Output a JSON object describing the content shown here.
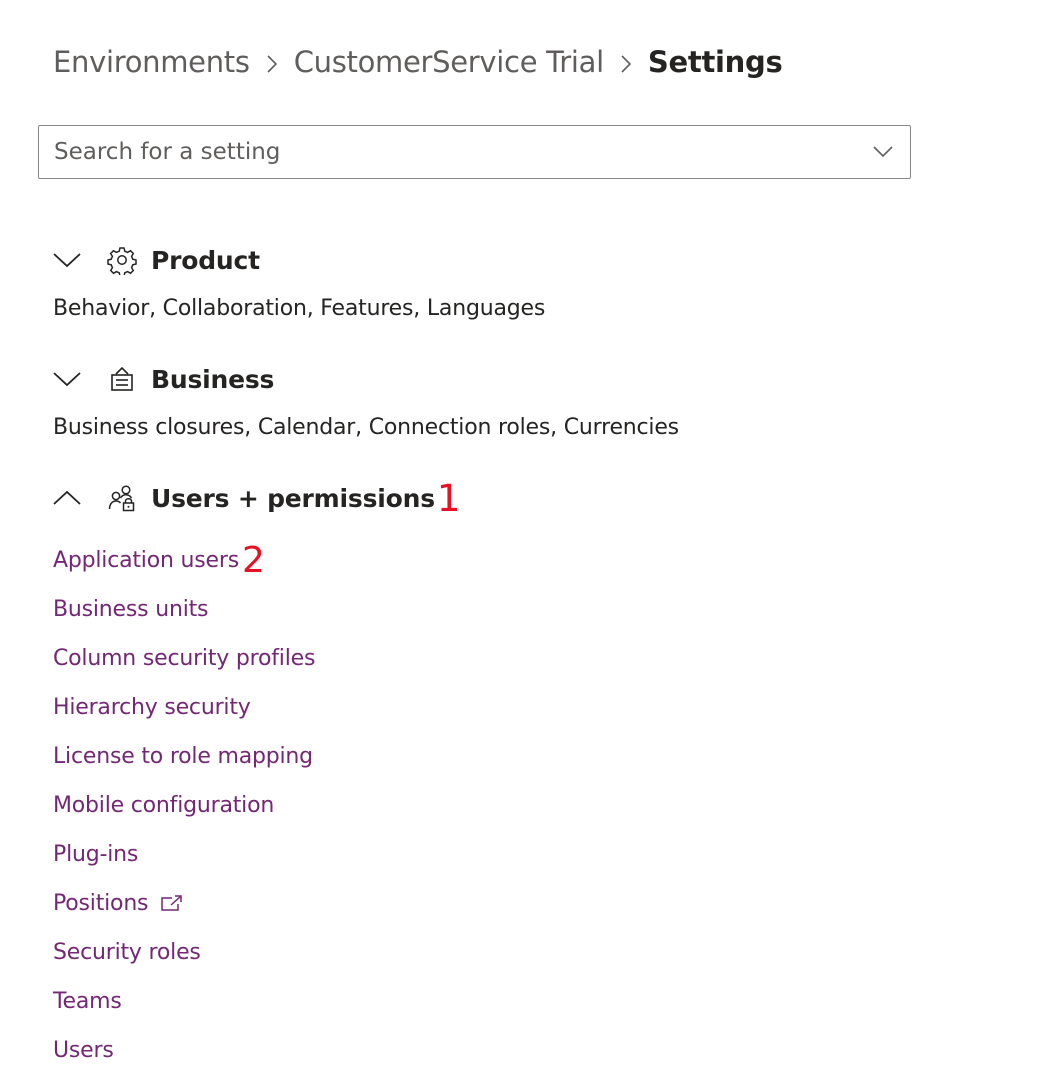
{
  "breadcrumb": {
    "items": [
      "Environments",
      "CustomerService Trial"
    ],
    "current": "Settings"
  },
  "search": {
    "placeholder": "Search for a setting",
    "value": ""
  },
  "sections": [
    {
      "title": "Product",
      "icon": "gear-icon",
      "expanded": false,
      "summary": "Behavior, Collaboration, Features, Languages"
    },
    {
      "title": "Business",
      "icon": "building-icon",
      "expanded": false,
      "summary": "Business closures, Calendar, Connection roles, Currencies"
    },
    {
      "title": "Users + permissions",
      "icon": "users-lock-icon",
      "expanded": true,
      "marker": "1",
      "links": [
        {
          "label": "Application users",
          "marker": "2"
        },
        {
          "label": "Business units"
        },
        {
          "label": "Column security profiles"
        },
        {
          "label": "Hierarchy security"
        },
        {
          "label": "License to role mapping"
        },
        {
          "label": "Mobile configuration"
        },
        {
          "label": "Plug-ins"
        },
        {
          "label": "Positions",
          "external": true
        },
        {
          "label": "Security roles"
        },
        {
          "label": "Teams"
        },
        {
          "label": "Users"
        }
      ]
    }
  ],
  "colors": {
    "link": "#742774",
    "text": "#252423",
    "muted": "#605e5c",
    "marker": "#e81123",
    "border": "#8a8886"
  }
}
